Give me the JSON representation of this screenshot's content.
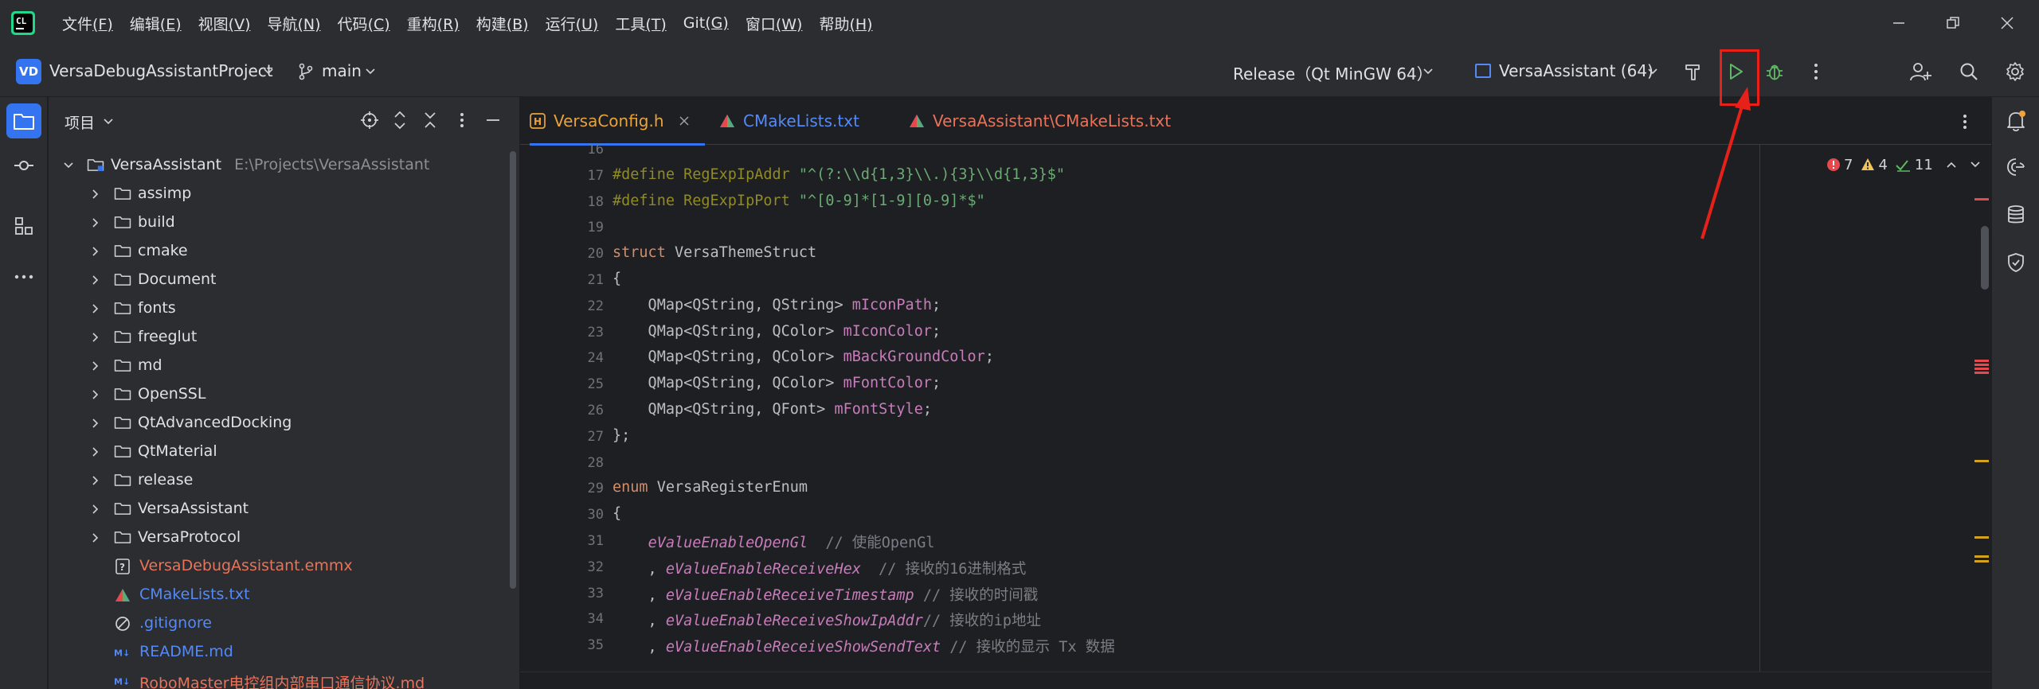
{
  "menu": {
    "items": [
      {
        "text": "文件",
        "mnemonic": "(F)"
      },
      {
        "text": "编辑",
        "mnemonic": "(E)"
      },
      {
        "text": "视图",
        "mnemonic": "(V)"
      },
      {
        "text": "导航",
        "mnemonic": "(N)"
      },
      {
        "text": "代码",
        "mnemonic": "(C)"
      },
      {
        "text": "重构",
        "mnemonic": "(R)"
      },
      {
        "text": "构建",
        "mnemonic": "(B)"
      },
      {
        "text": "运行",
        "mnemonic": "(U)"
      },
      {
        "text": "工具",
        "mnemonic": "(T)"
      },
      {
        "text": "Git",
        "mnemonic": "(G)"
      },
      {
        "text": "窗口",
        "mnemonic": "(W)"
      },
      {
        "text": "帮助",
        "mnemonic": "(H)"
      }
    ]
  },
  "toolbar": {
    "project_badge": "VD",
    "project_name": "VersaDebugAssistantProject",
    "branch": "main",
    "build_config": "Release（Qt MinGW 64）",
    "run_target": "VersaAssistant (64)"
  },
  "project_panel": {
    "title": "项目",
    "root": {
      "name": "VersaAssistant",
      "path": "E:\\Projects\\VersaAssistant"
    },
    "folders": [
      "assimp",
      "build",
      "cmake",
      "Document",
      "fonts",
      "freeglut",
      "md",
      "OpenSSL",
      "QtAdvancedDocking",
      "QtMaterial",
      "release",
      "VersaAssistant",
      "VersaProtocol"
    ],
    "files": [
      {
        "name": "VersaDebugAssistant.emmx",
        "icon": "?",
        "color": "#e8735a"
      },
      {
        "name": "CMakeLists.txt",
        "icon": "cmake",
        "color": "#548af7"
      },
      {
        "name": ".gitignore",
        "icon": "ignore",
        "color": "#548af7"
      },
      {
        "name": "README.md",
        "icon": "M↓",
        "color": "#548af7"
      },
      {
        "name": "RoboMaster电控组内部串口通信协议.md",
        "icon": "M↓",
        "color": "#e8735a"
      }
    ]
  },
  "tabs": [
    {
      "label": "VersaConfig.h",
      "icon": "H",
      "color": "#e8a33c",
      "active": true,
      "closable": true
    },
    {
      "label": "CMakeLists.txt",
      "icon": "cmake",
      "color": "#548af7",
      "active": false,
      "closable": false
    },
    {
      "label": "VersaAssistant\\CMakeLists.txt",
      "icon": "cmake",
      "color": "#e8735a",
      "active": false,
      "closable": false
    }
  ],
  "inspection": {
    "errors": "7",
    "warnings": "4",
    "weak": "11"
  },
  "code": {
    "line_numbers": [
      "16",
      "17",
      "18",
      "19",
      "20",
      "21",
      "22",
      "23",
      "24",
      "25",
      "26",
      "27",
      "28",
      "29",
      "30",
      "31",
      "32",
      "33",
      "34",
      "35"
    ],
    "lines": [
      [],
      [
        {
          "c": "mac",
          "t": "#define"
        },
        {
          "c": "",
          "t": " "
        },
        {
          "c": "mac",
          "t": "RegExpIpAddr"
        },
        {
          "c": "",
          "t": " "
        },
        {
          "c": "str",
          "t": "\"^(?:\\\\d{1,3}\\\\.){3}\\\\d{1,3}$\""
        }
      ],
      [
        {
          "c": "mac",
          "t": "#define"
        },
        {
          "c": "",
          "t": " "
        },
        {
          "c": "mac",
          "t": "RegExpIpPort"
        },
        {
          "c": "",
          "t": " "
        },
        {
          "c": "str",
          "t": "\"^[0-9]*[1-9][0-9]*$\""
        }
      ],
      [],
      [
        {
          "c": "kw",
          "t": "struct"
        },
        {
          "c": "",
          "t": " VersaThemeStruct"
        }
      ],
      [
        {
          "c": "",
          "t": "{"
        }
      ],
      [
        {
          "c": "",
          "t": "    QMap<QString, QString> "
        },
        {
          "c": "fld",
          "t": "mIconPath"
        },
        {
          "c": "",
          "t": ";"
        }
      ],
      [
        {
          "c": "",
          "t": "    QMap<QString, QColor> "
        },
        {
          "c": "fld",
          "t": "mIconColor"
        },
        {
          "c": "",
          "t": ";"
        }
      ],
      [
        {
          "c": "",
          "t": "    QMap<QString, QColor> "
        },
        {
          "c": "fld",
          "t": "mBackGroundColor"
        },
        {
          "c": "",
          "t": ";"
        }
      ],
      [
        {
          "c": "",
          "t": "    QMap<QString, QColor> "
        },
        {
          "c": "fld",
          "t": "mFontColor"
        },
        {
          "c": "",
          "t": ";"
        }
      ],
      [
        {
          "c": "",
          "t": "    QMap<QString, QFont> "
        },
        {
          "c": "fld",
          "t": "mFontStyle"
        },
        {
          "c": "",
          "t": ";"
        }
      ],
      [
        {
          "c": "",
          "t": "};"
        }
      ],
      [],
      [
        {
          "c": "kw",
          "t": "enum"
        },
        {
          "c": "",
          "t": " VersaRegisterEnum"
        }
      ],
      [
        {
          "c": "",
          "t": "{"
        }
      ],
      [
        {
          "c": "",
          "t": "    "
        },
        {
          "c": "enm",
          "t": "eValueEnableOpenGl"
        },
        {
          "c": "",
          "t": "  "
        },
        {
          "c": "cmt",
          "t": "// 使能OpenGl"
        }
      ],
      [
        {
          "c": "",
          "t": "    , "
        },
        {
          "c": "enm",
          "t": "eValueEnableReceiveHex"
        },
        {
          "c": "",
          "t": "  "
        },
        {
          "c": "cmt",
          "t": "// 接收的16进制格式"
        }
      ],
      [
        {
          "c": "",
          "t": "    , "
        },
        {
          "c": "enm",
          "t": "eValueEnableReceiveTimestamp"
        },
        {
          "c": "",
          "t": " "
        },
        {
          "c": "cmt",
          "t": "// 接收的时间戳"
        }
      ],
      [
        {
          "c": "",
          "t": "    , "
        },
        {
          "c": "enm",
          "t": "eValueEnableReceiveShowIpAddr"
        },
        {
          "c": "cmt",
          "t": "// 接收的ip地址"
        }
      ],
      [
        {
          "c": "",
          "t": "    , "
        },
        {
          "c": "enm",
          "t": "eValueEnableReceiveShowSendText"
        },
        {
          "c": "",
          "t": " "
        },
        {
          "c": "cmt",
          "t": "// 接收的显示 Tx 数据"
        }
      ]
    ]
  },
  "colors": {
    "accent": "#3574f0",
    "run_green": "#5fb865",
    "annotation_red": "#e8201a"
  }
}
